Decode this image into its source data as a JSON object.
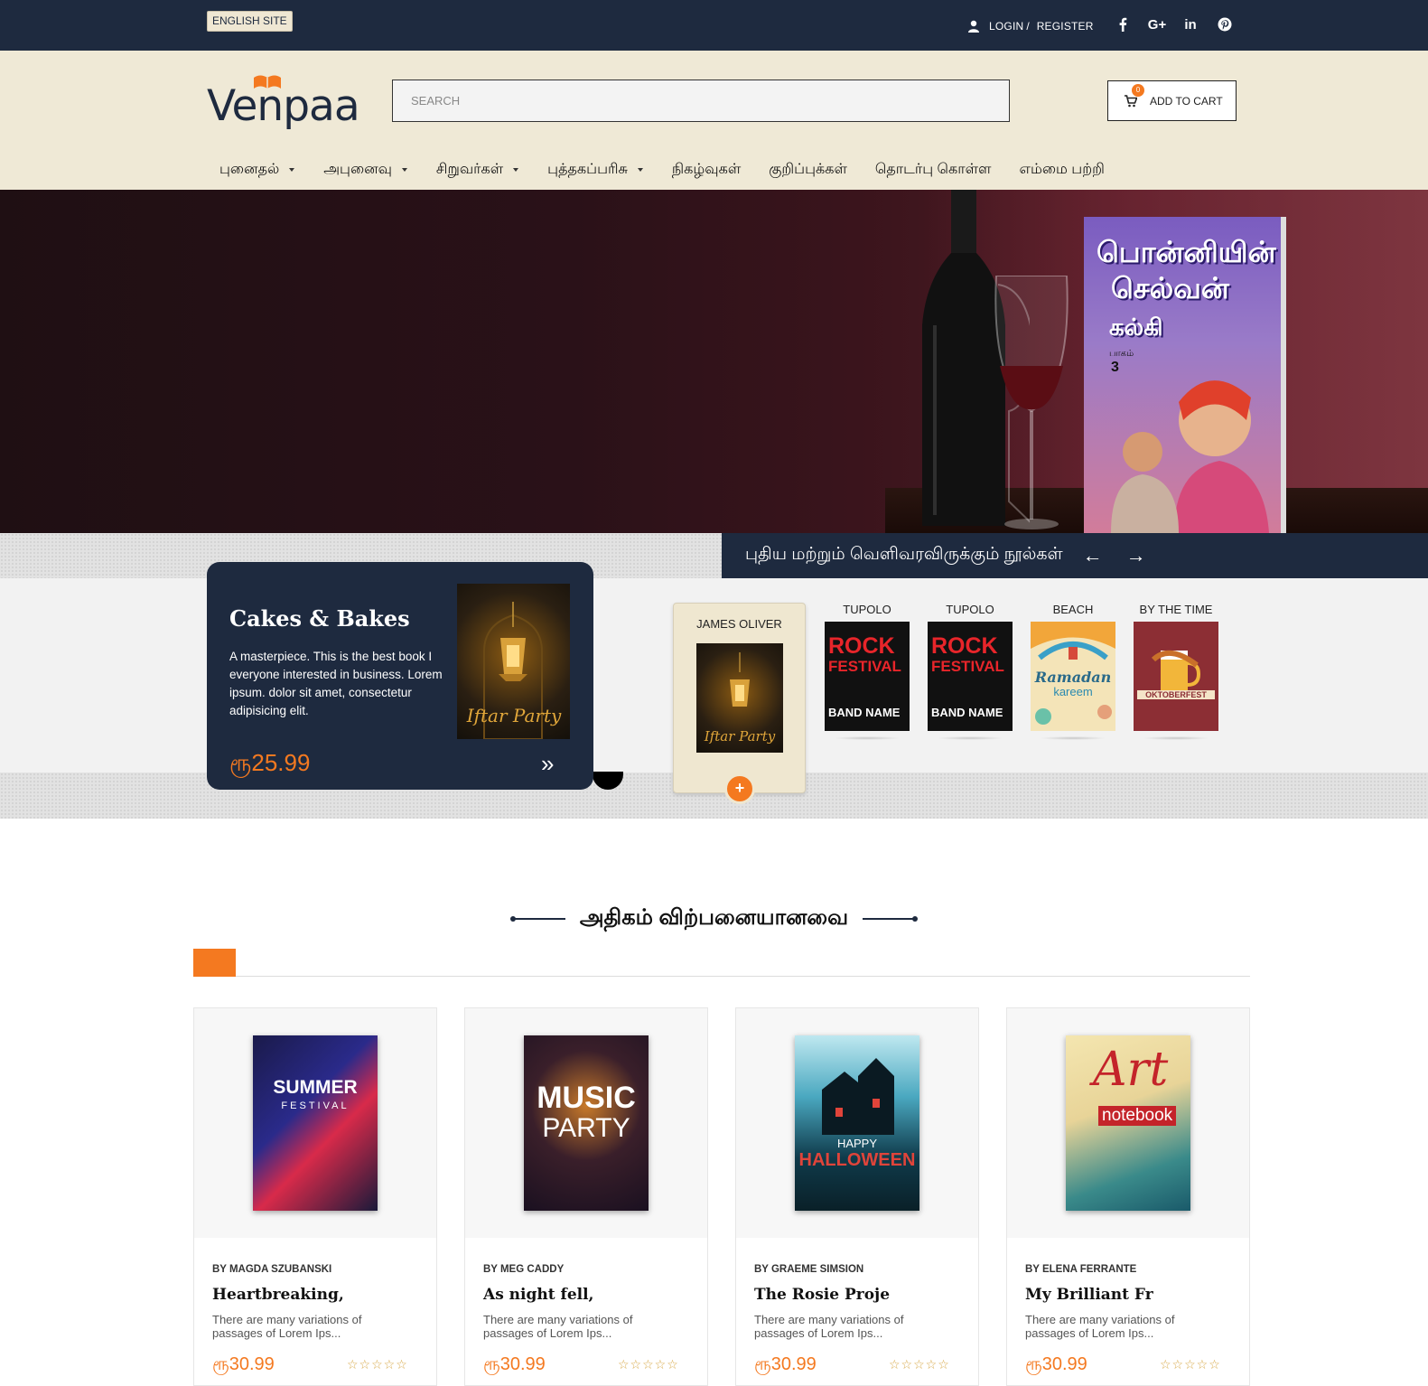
{
  "topbar": {
    "language_button": "ENGLISH SITE",
    "login": "LOGIN",
    "separator": "/",
    "register": "REGISTER",
    "social": [
      "facebook-icon",
      "google-plus-icon",
      "linkedin-icon",
      "pinterest-icon"
    ]
  },
  "header": {
    "logo": "Venpaa",
    "search_placeholder": "SEARCH",
    "cart_label": "ADD TO CART",
    "cart_count": "0"
  },
  "nav": {
    "items": [
      {
        "label": "புனைதல்",
        "dropdown": true
      },
      {
        "label": "அபுனைவு",
        "dropdown": true
      },
      {
        "label": "சிறுவர்கள்",
        "dropdown": true
      },
      {
        "label": "புத்தகப்பரிசு",
        "dropdown": true
      },
      {
        "label": "நிகழ்வுகள்",
        "dropdown": false
      },
      {
        "label": "குறிப்புக்கள்",
        "dropdown": false
      },
      {
        "label": "தொடர்பு கொள்ள",
        "dropdown": false
      },
      {
        "label": "எம்மை பற்றி",
        "dropdown": false
      }
    ]
  },
  "hero": {
    "book_title_line1": "பொன்னியின்",
    "book_title_line2": "செல்வன்",
    "book_author": "கல்கி",
    "book_part_label": "பாகம்",
    "book_part": "3"
  },
  "featured": {
    "section_label": "புதிய மற்றும் வெளிவரவிருக்கும் நூல்கள்",
    "prev": "←",
    "next": "→",
    "card": {
      "title": "Cakes & Bakes",
      "description": "A masterpiece. This is the best book I everyone interested in business. Lorem ipsum. dolor sit amet, consectetur adipisicing elit.",
      "price": "ரூ25.99",
      "next_arrow": "»"
    },
    "active": {
      "name": "JAMES OLIVER",
      "plus": "+"
    },
    "thumbs": [
      {
        "name": "TUPOLO",
        "cover": "rock-festival-cover"
      },
      {
        "name": "TUPOLO",
        "cover": "rock-festival-cover"
      },
      {
        "name": "BEACH",
        "cover": "ramadan-kareem-cover"
      },
      {
        "name": "BY THE TIME",
        "cover": "oktoberfest-cover"
      }
    ],
    "cover_text": {
      "iftar": "Iftar Party",
      "rock1": "ROCK",
      "rock2": "FESTIVAL",
      "band": "BAND NAME",
      "ramadan": "Ramadan",
      "kareem": "kareem",
      "oktober": "OKTOBERFEST"
    }
  },
  "best_sellers": {
    "title": "அதிகம் விற்பனையானவை",
    "products": [
      {
        "author": "BY MAGDA SZUBANSKI",
        "title": "Heartbreaking,",
        "desc": "There are many variations of passages of Lorem Ips...",
        "price": "ரூ30.99",
        "stars": "☆☆☆☆☆",
        "cover_line1": "SUMMER",
        "cover_line2": "FESTIVAL"
      },
      {
        "author": "BY MEG CADDY",
        "title": "As night fell,",
        "desc": "There are many variations of passages of Lorem Ips...",
        "price": "ரூ30.99",
        "stars": "☆☆☆☆☆",
        "cover_line1": "MUSIC",
        "cover_line2": "PARTY"
      },
      {
        "author": "BY GRAEME SIMSION",
        "title": "The Rosie Proje",
        "desc": "There are many variations of passages of Lorem Ips...",
        "price": "ரூ30.99",
        "stars": "☆☆☆☆☆",
        "cover_line1": "HAPPY",
        "cover_line2": "HALLOWEEN"
      },
      {
        "author": "BY ELENA FERRANTE",
        "title": "My Brilliant Fr",
        "desc": "There are many variations of passages of Lorem Ips...",
        "price": "ரூ30.99",
        "stars": "☆☆☆☆☆",
        "cover_line1": "Art",
        "cover_line2": "notebook"
      }
    ]
  },
  "colors": {
    "navy": "#1e2a3f",
    "cream": "#efe9d6",
    "accent": "#f47920"
  }
}
